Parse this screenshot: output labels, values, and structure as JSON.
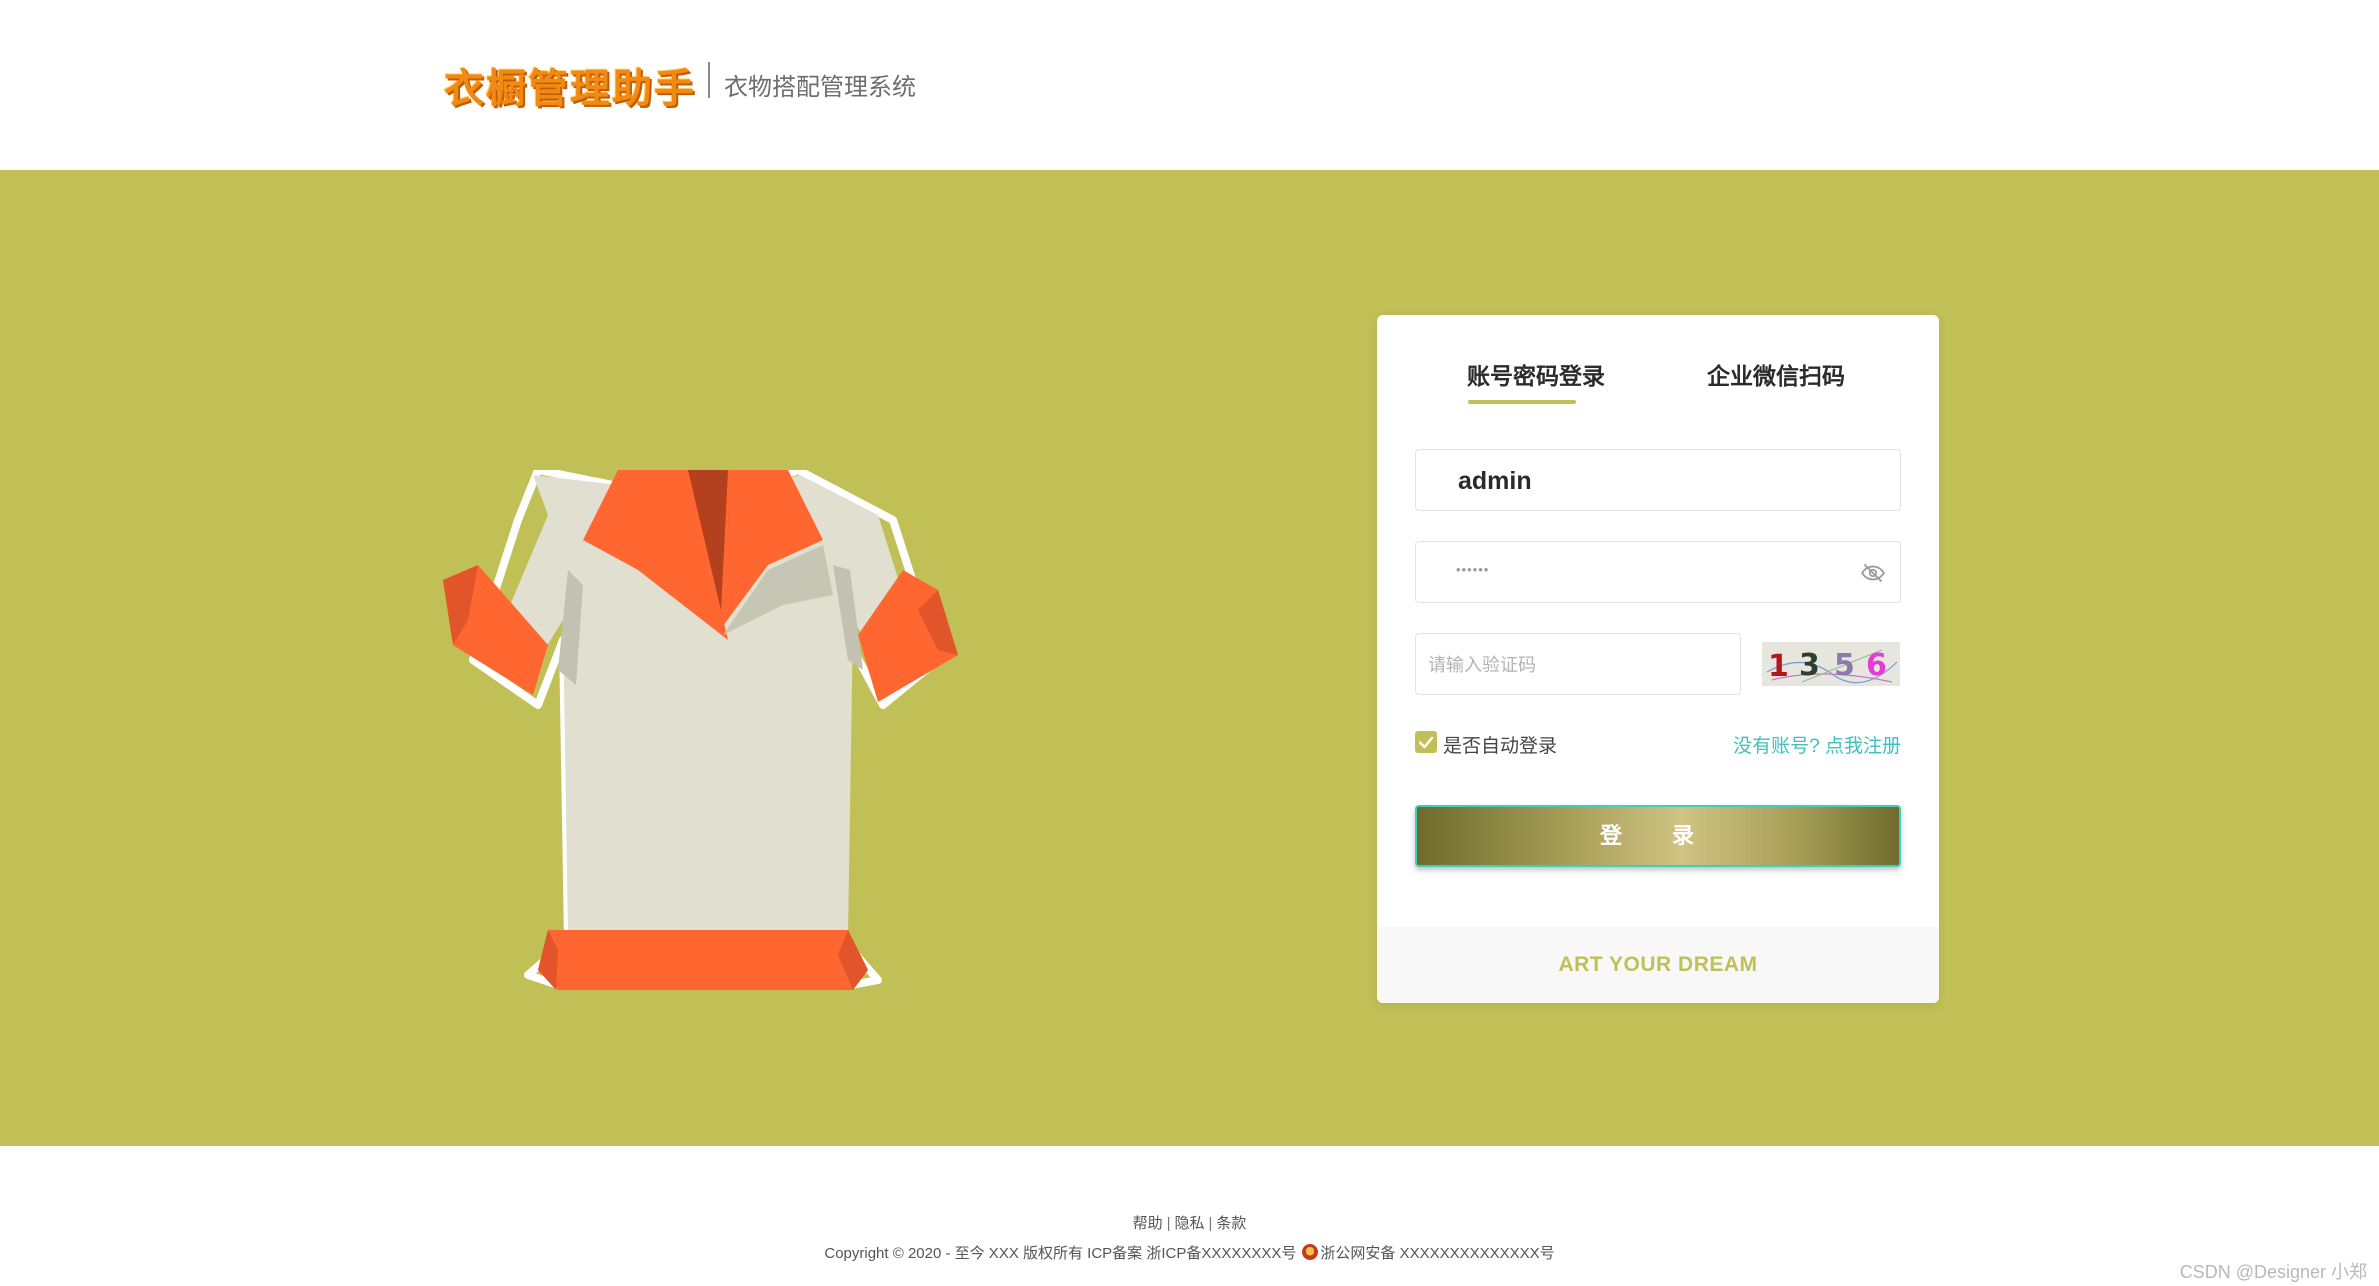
{
  "header": {
    "logo_text": "衣橱管理助手",
    "subtitle": "衣物搭配管理系统"
  },
  "login": {
    "tabs": [
      {
        "label": "账号密码登录",
        "active": true
      },
      {
        "label": "企业微信扫码",
        "active": false
      }
    ],
    "username_value": "admin",
    "password_masked": "••••••",
    "captcha_placeholder": "请输入验证码",
    "captcha_digits": [
      "1",
      "3",
      "5",
      "6"
    ],
    "auto_login_label": "是否自动登录",
    "auto_login_checked": true,
    "register_link": "没有账号? 点我注册",
    "login_button": "登 录",
    "card_footer": "ART YOUR DREAM"
  },
  "footer": {
    "links": [
      "帮助",
      "隐私",
      "条款"
    ],
    "copyright": "Copyright © 2020 - 至今 XXX 版权所有 ICP备案 浙ICP备XXXXXXXX号",
    "police_record": "浙公网安备 XXXXXXXXXXXXXX号",
    "watermark": "CSDN @Designer 小郑"
  },
  "colors": {
    "accent": "#c1c057",
    "logo_orange": "#f08a12",
    "link_teal": "#3fbfbf"
  },
  "icons": [
    "shirt-illustration",
    "eye-slash-icon",
    "check-icon",
    "police-badge-icon"
  ]
}
